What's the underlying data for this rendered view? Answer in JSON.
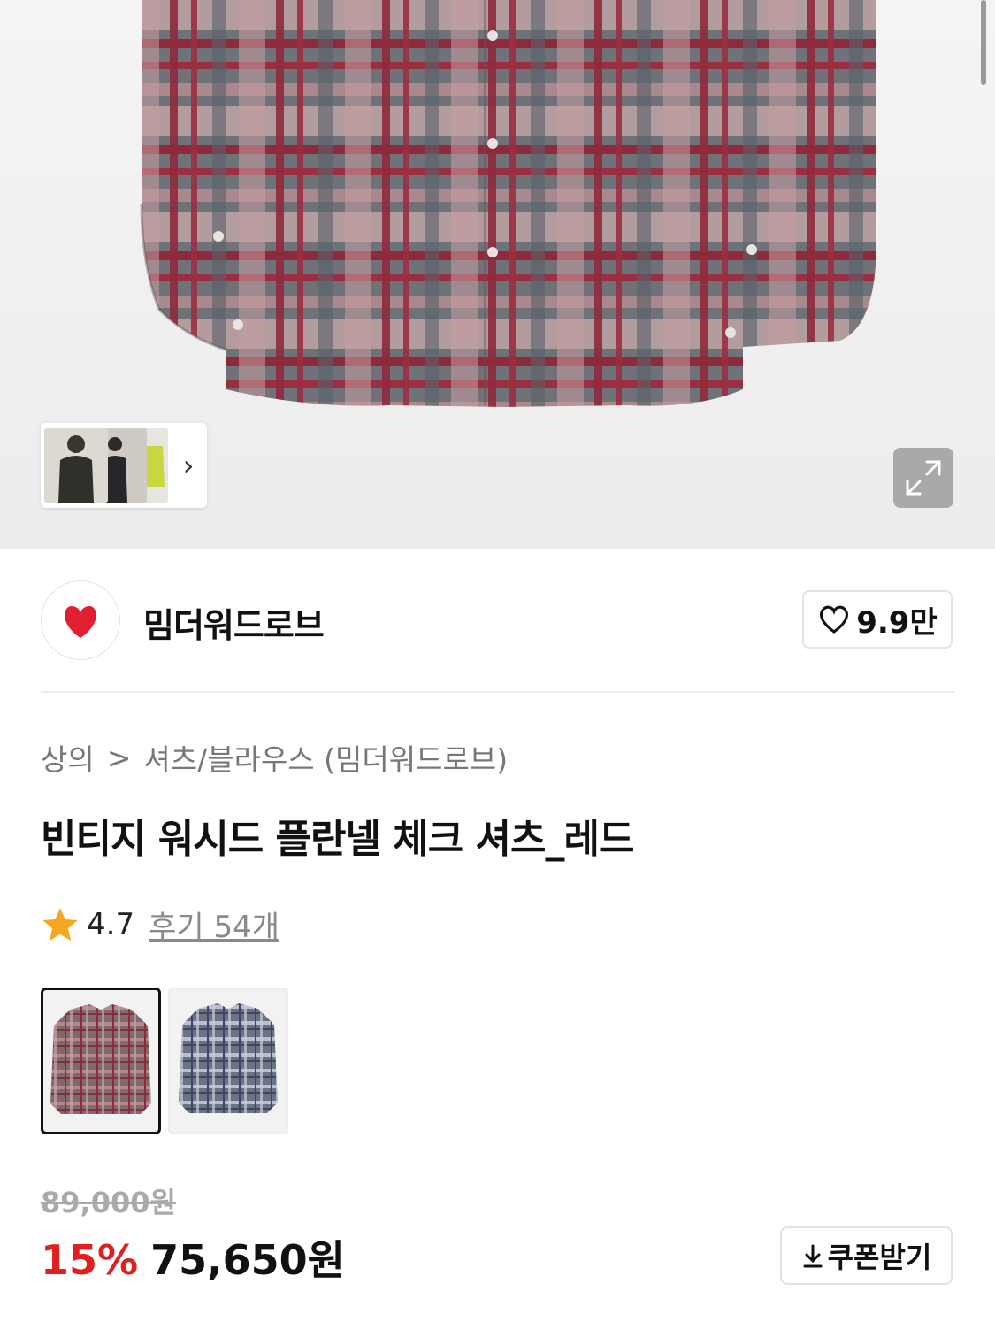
{
  "gallery": {
    "next_symbol": "›"
  },
  "brand": {
    "name": "밈더워드로브",
    "like_count": "9.9만"
  },
  "breadcrumb": {
    "category": "상의",
    "separator": ">",
    "subcategory": "셔츠/블라우스 (밈더워드로브)"
  },
  "product": {
    "title": "빈티지 워시드 플란넬 체크 셔츠_레드",
    "rating": "4.7",
    "review_link": "후기 54개",
    "variants": [
      "red",
      "blue"
    ],
    "original_price": "89,000원",
    "discount": "15%",
    "sale_price": "75,650원",
    "coupon_label": "쿠폰받기"
  },
  "colors": {
    "accent_red": "#e02020",
    "star": "#f5a623"
  }
}
